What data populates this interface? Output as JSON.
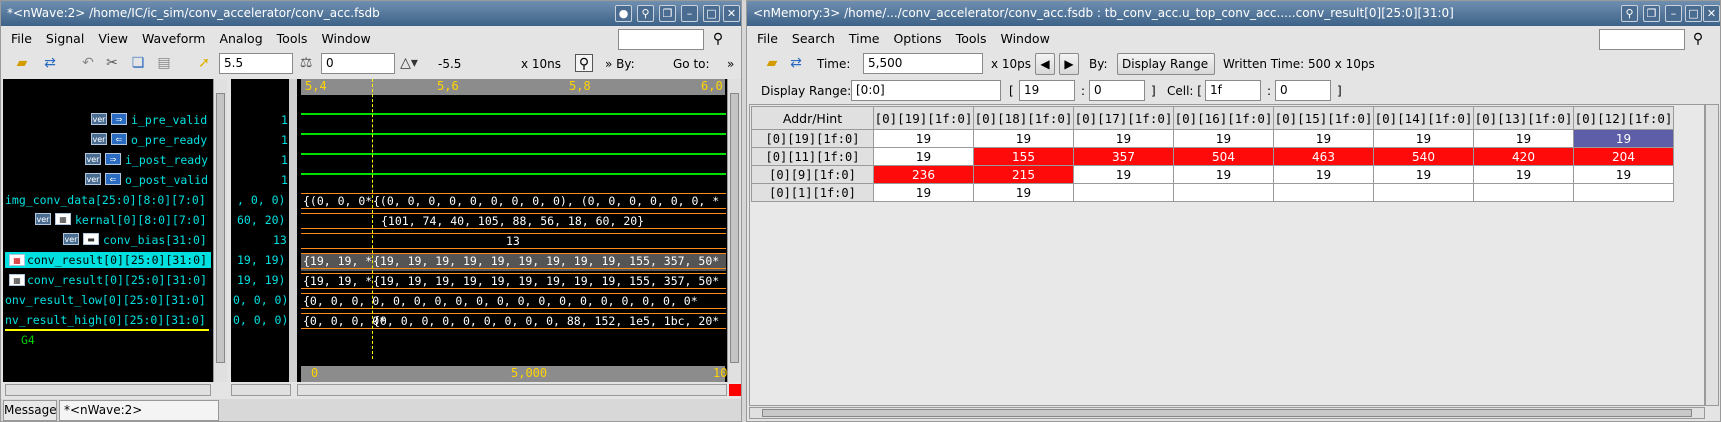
{
  "wave": {
    "title": "*<nWave:2> /home/IC/ic_sim/conv_accelerator/conv_acc.fsdb",
    "menu": [
      "File",
      "Signal",
      "View",
      "Waveform",
      "Analog",
      "Tools",
      "Window"
    ],
    "toolbar": {
      "cursor_value": "5.5",
      "marker_value": "0",
      "delta": "-5.5",
      "scale": "x 10ns",
      "by_label": "By:",
      "goto_label": "Go to:"
    },
    "ruler": [
      "5,4",
      "5,6",
      "5,8",
      "6,0"
    ],
    "signals": [
      {
        "name": "i_pre_valid",
        "value": "1"
      },
      {
        "name": "o_pre_ready",
        "value": "1"
      },
      {
        "name": "i_post_ready",
        "value": "1"
      },
      {
        "name": "o_post_valid",
        "value": "1"
      },
      {
        "name": "img_conv_data[25:0][8:0][7:0]",
        "value": ", 0, 0)"
      },
      {
        "name": "kernal[0][8:0][7:0]",
        "value": "60, 20)"
      },
      {
        "name": "conv_bias[31:0]",
        "value": "13"
      },
      {
        "name": "conv_result[0][25:0][31:0]",
        "value": "19, 19)"
      },
      {
        "name": "conv_result[0][25:0][31:0]",
        "value": "19, 19)"
      },
      {
        "name": "onv_result_low[0][25:0][31:0]",
        "value": "0, 0, 0)"
      },
      {
        "name": "nv_result_high[0][25:0][31:0]",
        "value": "0, 0, 0)"
      }
    ],
    "group_label": "G4",
    "bus_rows": [
      {
        "left": "{(0, 0, 0*",
        "right": "{(0, 0, 0, 0, 0, 0, 0, 0, 0), (0, 0, 0, 0, 0, 0, *"
      },
      {
        "left": "",
        "right": "{101, 74, 40, 105, 88, 56, 18, 60, 20}"
      },
      {
        "left": "",
        "right": "13"
      },
      {
        "left": "{19, 19, *",
        "right": "{19, 19, 19, 19, 19, 19, 19, 19, 19, 155, 357, 50*"
      },
      {
        "left": "{19, 19, *",
        "right": "{19, 19, 19, 19, 19, 19, 19, 19, 19, 155, 357, 50*"
      },
      {
        "left": "{0, 0, 0, 0, 0, 0, 0, 0, 0, 0, 0, 0, 0, 0, 0, 0, 0, 0, 0*",
        "right": ""
      },
      {
        "left": "{0, 0, 0, 0*",
        "right": "{0, 0, 0, 0, 0, 0, 0, 0, 0, 88, 152, 1e5, 1bc, 20*"
      }
    ],
    "bottom_ruler": [
      "0",
      "5,000",
      "10"
    ],
    "tabs": [
      "Message",
      "*<nWave:2> conv_acc.fsdb"
    ]
  },
  "memory": {
    "title": "<nMemory:3> /home/.../conv_accelerator/conv_acc.fsdb : tb_conv_acc.u_top_conv_acc.....conv_result[0][25:0][31:0]",
    "menu": [
      "File",
      "Search",
      "Time",
      "Options",
      "Tools",
      "Window"
    ],
    "time_label": "Time:",
    "time_value": "5,500",
    "time_unit": "x 10ps",
    "by_label": "By:",
    "by_value": "Display Range",
    "written_time": "Written Time:  500 x 10ps",
    "display_range_label": "Display Range:",
    "display_range_value": "[0:0]",
    "range_hi": "19",
    "range_lo": "0",
    "cell_label": "Cell: [",
    "cell_hi": "1f",
    "cell_lo": "0",
    "columns": [
      "Addr/Hint",
      "[0][19][1f:0]",
      "[0][18][1f:0]",
      "[0][17][1f:0]",
      "[0][16][1f:0]",
      "[0][15][1f:0]",
      "[0][14][1f:0]",
      "[0][13][1f:0]",
      "[0][12][1f:0]"
    ],
    "rows": [
      {
        "addr": "[0][19][1f:0]",
        "cells": [
          "19",
          "19",
          "19",
          "19",
          "19",
          "19",
          "19",
          "19"
        ]
      },
      {
        "addr": "[0][11][1f:0]",
        "cells": [
          "19",
          "155",
          "357",
          "504",
          "463",
          "540",
          "420",
          "204"
        ]
      },
      {
        "addr": "[0][9][1f:0]",
        "cells": [
          "236",
          "215",
          "19",
          "19",
          "19",
          "19",
          "19",
          "19"
        ]
      },
      {
        "addr": "[0][1][1f:0]",
        "cells": [
          "19",
          "19",
          "",
          "",
          "",
          "",
          "",
          ""
        ]
      }
    ],
    "red_cells": [
      [
        1,
        1
      ],
      [
        1,
        2
      ],
      [
        1,
        3
      ],
      [
        1,
        4
      ],
      [
        1,
        5
      ],
      [
        1,
        6
      ],
      [
        1,
        7
      ],
      [
        2,
        0
      ],
      [
        2,
        1
      ]
    ],
    "selected_cell": [
      0,
      7
    ]
  }
}
